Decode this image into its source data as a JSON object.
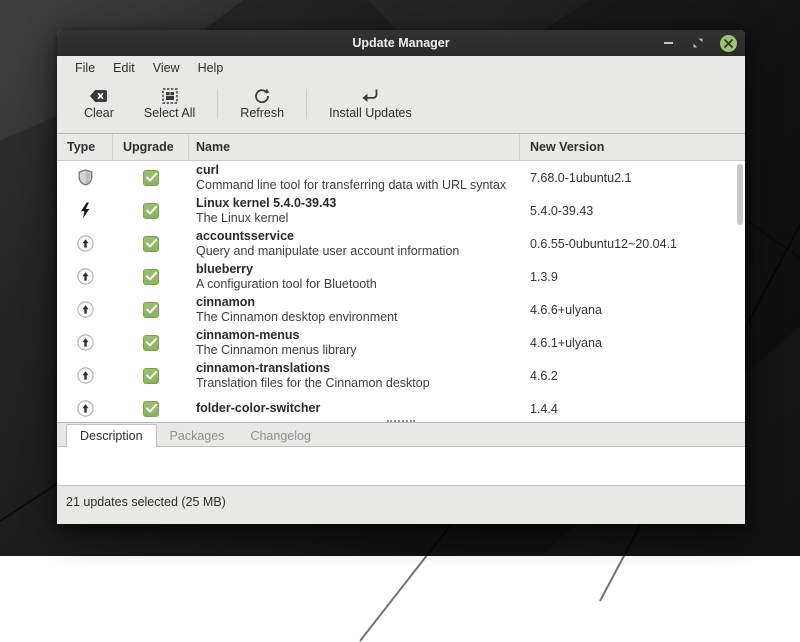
{
  "window": {
    "title": "Update Manager"
  },
  "window_controls": {
    "minimize_icon": "minimize-icon",
    "restore_icon": "restore-icon",
    "close_icon": "close-icon"
  },
  "menu": {
    "items": [
      "File",
      "Edit",
      "View",
      "Help"
    ]
  },
  "toolbar": {
    "buttons": [
      {
        "label": "Clear",
        "icon": "clear-icon"
      },
      {
        "label": "Select All",
        "icon": "select-all-icon"
      },
      {
        "label": "Refresh",
        "icon": "refresh-icon"
      },
      {
        "label": "Install Updates",
        "icon": "install-updates-icon"
      }
    ]
  },
  "table": {
    "headers": [
      "Type",
      "Upgrade",
      "Name",
      "New Version"
    ],
    "rows": [
      {
        "type": "security",
        "type_icon": "shield-icon",
        "checked": true,
        "name": "curl",
        "description": "Command line tool for transferring data with URL syntax",
        "version": "7.68.0-1ubuntu2.1"
      },
      {
        "type": "kernel",
        "type_icon": "kernel-bolt-icon",
        "checked": true,
        "name": "Linux kernel 5.4.0-39.43",
        "description": "The Linux kernel",
        "version": "5.4.0-39.43"
      },
      {
        "type": "package",
        "type_icon": "upgrade-arrow-icon",
        "checked": true,
        "name": "accountsservice",
        "description": "Query and manipulate user account information",
        "version": "0.6.55-0ubuntu12~20.04.1"
      },
      {
        "type": "package",
        "type_icon": "upgrade-arrow-icon",
        "checked": true,
        "name": "blueberry",
        "description": "A configuration tool for Bluetooth",
        "version": "1.3.9"
      },
      {
        "type": "package",
        "type_icon": "upgrade-arrow-icon",
        "checked": true,
        "name": "cinnamon",
        "description": "The Cinnamon desktop environment",
        "version": "4.6.6+ulyana"
      },
      {
        "type": "package",
        "type_icon": "upgrade-arrow-icon",
        "checked": true,
        "name": "cinnamon-menus",
        "description": "The Cinnamon menus library",
        "version": "4.6.1+ulyana"
      },
      {
        "type": "package",
        "type_icon": "upgrade-arrow-icon",
        "checked": true,
        "name": "cinnamon-translations",
        "description": "Translation files for the Cinnamon desktop",
        "version": "4.6.2"
      },
      {
        "type": "package",
        "type_icon": "upgrade-arrow-icon",
        "checked": true,
        "name": "folder-color-switcher",
        "description": "",
        "version": "1.4.4"
      }
    ]
  },
  "tabs": [
    {
      "label": "Description",
      "active": true
    },
    {
      "label": "Packages",
      "active": false
    },
    {
      "label": "Changelog",
      "active": false
    }
  ],
  "statusbar": {
    "text": "21 updates selected (25 MB)"
  },
  "colors": {
    "titlebar": "#2c2c2c",
    "chrome_bg": "#e8e8e7",
    "list_bg": "#ffffff",
    "checkbox_green": "#8ab35e",
    "close_button_green": "#9fc276"
  }
}
